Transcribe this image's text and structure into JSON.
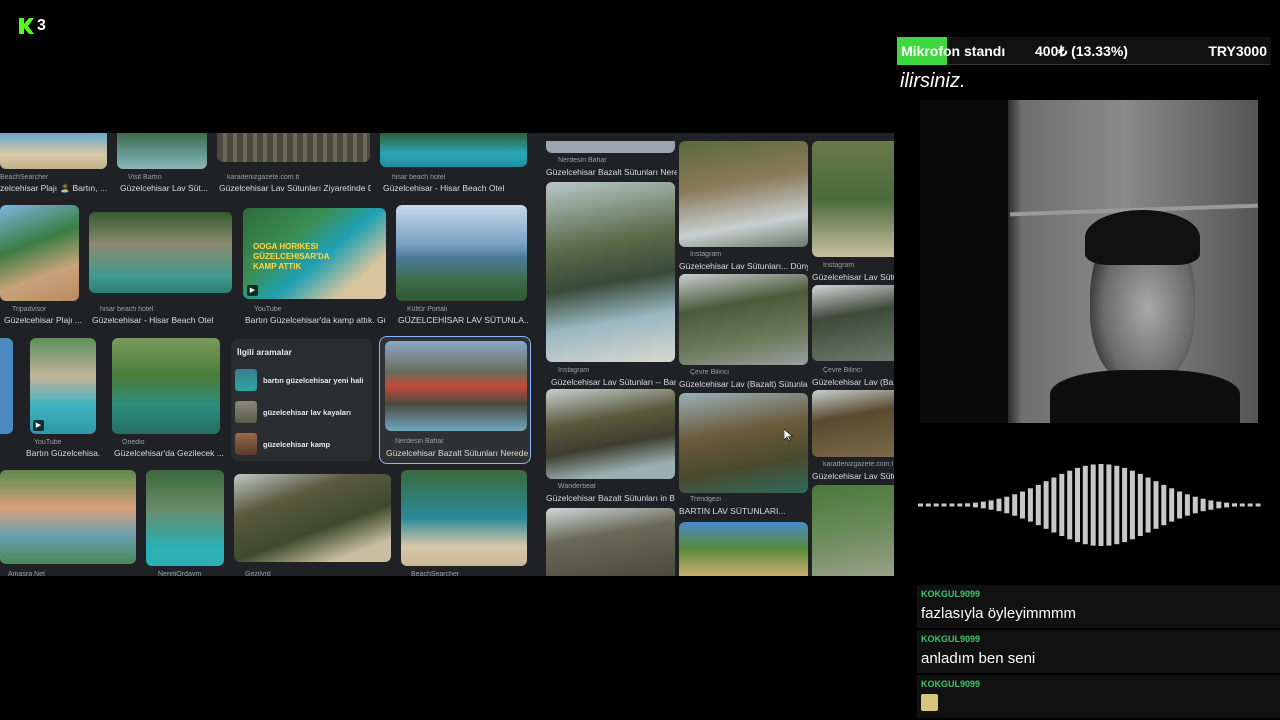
{
  "logo": {
    "number": "3"
  },
  "ticker": {
    "title": "Mikrofon standı",
    "progress": "400₺ (13.33%)",
    "goal": "TRY3000",
    "accent_color": "#3fd63f"
  },
  "subtitle": "ilirsiniz.",
  "screen": {
    "row1": [
      {
        "src": "BeachSearcher",
        "caption": "zelcehisar Plajı 🏝️ Bartın, ..."
      },
      {
        "src": "Visit Bartın",
        "caption": "Güzelcehisar Lav Süt..."
      },
      {
        "src": "karadenizgazete.com.tr",
        "caption": "Güzelcehisar Lav Sütunları Ziyaretinde D..."
      },
      {
        "src": "hisar beach hotel",
        "caption": "Güzelcehisar - Hisar Beach Otel"
      }
    ],
    "row2": [
      {
        "src": "Tripadvisor",
        "caption": "Güzelcehisar Plajı ..."
      },
      {
        "src": "hisar beach hotel",
        "caption": "Güzelcehisar - Hisar Beach Otel"
      },
      {
        "src": "YouTube",
        "caption": "Bartın Güzelcehisar'da kamp attık. Gü...",
        "overlay": "ooga horikesi güzelcehisar'da kamp attık"
      },
      {
        "src": "Kültür Portalı",
        "caption": "GÜZELCEHİSAR LAV SÜTUNLA..."
      }
    ],
    "row3": [
      {
        "src": "YouTube",
        "caption": "Bartın Güzelcehisa..."
      },
      {
        "src": "Onedio",
        "caption": "Güzelcehisar'da Gezilecek ..."
      },
      {
        "src": "Nerdesin Bahar",
        "caption": "Güzelcehisar Bazalt Sütunları Nerede ..."
      }
    ],
    "row4": [
      {
        "src": "Amasra Net"
      },
      {
        "src": "NereliOrdaym"
      },
      {
        "src": "Gezilyrd"
      },
      {
        "src": "BeachSearcher"
      }
    ],
    "related": {
      "title": "İlgili aramalar",
      "items": [
        "bartın güzelcehisar yeni hali",
        "güzelcehisar lav kayaları",
        "güzelcehisar kamp"
      ]
    },
    "right": [
      {
        "src": "Nerdesin Bahar",
        "caption": "Güzelcehisar Bazalt Sütunları Nerede?,..."
      },
      {
        "src": "Instagram",
        "caption": "Güzelcehisar Lav Sütunları... Dünyada e..."
      },
      {
        "src": "Instagram",
        "caption": "Güzelcehisar Lav Sütu..."
      },
      {
        "src": "Instagram",
        "caption": "Güzelcehisar Lav Sütunları -- Bartın..."
      },
      {
        "src": "Çevre Bilinci",
        "caption": "Güzelcehisar Lav (Bazalt) Sütunları..."
      },
      {
        "src": "Çevre Bilinci",
        "caption": "Güzelcehisar Lav (Bazalt) S..."
      },
      {
        "src": "Wanderbeat",
        "caption": "Güzelcehisar Bazalt Sütunları in Bartın,..."
      },
      {
        "src": "Trendgezi",
        "caption": "BARTIN LAV SÜTUNLARI..."
      },
      {
        "src": "karadenizgazete.com.tr",
        "caption": "Güzelcehisar Lav Sütu..."
      }
    ]
  },
  "chat": [
    {
      "user": "KOKGUL9099",
      "text": "fazlasıyla öyleyimmmm"
    },
    {
      "user": "KOKGUL9099",
      "text": "anladım ben seni"
    },
    {
      "user": "KOKGUL9099",
      "text": ""
    }
  ]
}
